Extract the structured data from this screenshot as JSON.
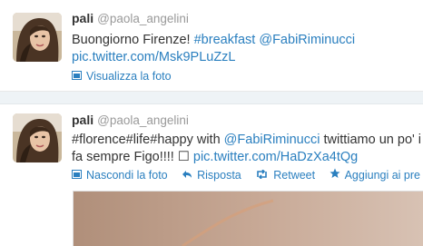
{
  "tweets": [
    {
      "name": "pali",
      "handle": "@paola_angelini",
      "line1": {
        "t1": "Buongiorno Firenze! ",
        "hashtag": "#breakfast",
        "mention": "@FabiRiminucci"
      },
      "line2": {
        "link": "pic.twitter.com/Msk9PLuZzL"
      },
      "action": "Visualizza la foto"
    },
    {
      "name": "pali",
      "handle": "@paola_angelini",
      "line1": {
        "hashtags": "#florence#life#happy",
        "t1": " with ",
        "mention": "@FabiRiminucci",
        "t2": " twittiamo un po' i"
      },
      "line2": {
        "t1": "fa sempre Figo!!!! ☐ ",
        "link": "pic.twitter.com/HaDzXa4tQg"
      },
      "actions": [
        "Nascondi la foto",
        "Risposta",
        "Retweet",
        "Aggiungi ai pre"
      ]
    }
  ],
  "colors": {
    "link": "#2a7fbf",
    "handle": "#999999",
    "text": "#333333"
  },
  "icons": [
    "photo-icon",
    "reply-icon",
    "retweet-icon",
    "star-icon"
  ]
}
